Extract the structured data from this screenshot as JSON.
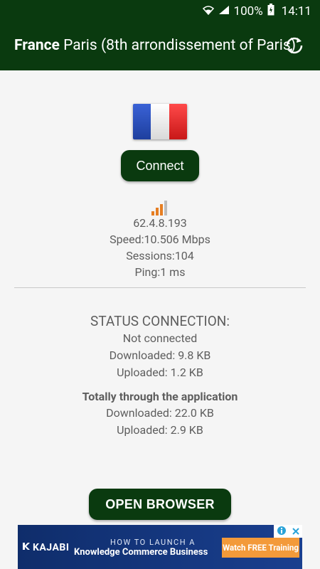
{
  "status_bar": {
    "battery": "100%",
    "time": "14:11"
  },
  "header": {
    "country": "France",
    "city": "Paris (8th arrondissement of Paris)"
  },
  "connect_label": "Connect",
  "server": {
    "ip": "62.4.8.193",
    "speed": "Speed:10.506 Mbps",
    "sessions": "Sessions:104",
    "ping": "Ping:1 ms",
    "signal_level": 3,
    "signal_max": 4
  },
  "status": {
    "title": "STATUS CONNECTION:",
    "state": "Not connected",
    "downloaded": "Downloaded: 9.8 KB",
    "uploaded": "Uploaded: 1.2 KB"
  },
  "totals": {
    "title": "Totally through the application",
    "downloaded": "Downloaded: 22.0 KB",
    "uploaded": "Uploaded: 2.9 KB"
  },
  "open_browser_label": "OPEN BROWSER",
  "ad": {
    "brand": "KAJABI",
    "headline": "HOW TO LAUNCH A",
    "subline": "Knowledge Commerce Business",
    "cta": "Watch FREE Training"
  },
  "colors": {
    "primary": "#0a3a0f",
    "signal_active": "#e67e22",
    "signal_inactive": "#bdbdbd",
    "ad_cta": "#f39a3a"
  }
}
